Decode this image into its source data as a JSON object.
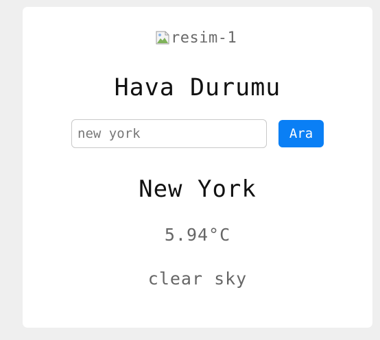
{
  "header": {
    "image_alt": "resim-1",
    "title": "Hava Durumu"
  },
  "search": {
    "value": "new york",
    "button_label": "Ara"
  },
  "weather": {
    "city": "New York",
    "temperature": "5.94°C",
    "description": "clear sky"
  },
  "colors": {
    "page_background": "#efefef",
    "card_background": "#ffffff",
    "button_background": "#0a7ff5",
    "button_text": "#ffffff"
  },
  "icons": {
    "broken_image": "broken-image-icon"
  }
}
